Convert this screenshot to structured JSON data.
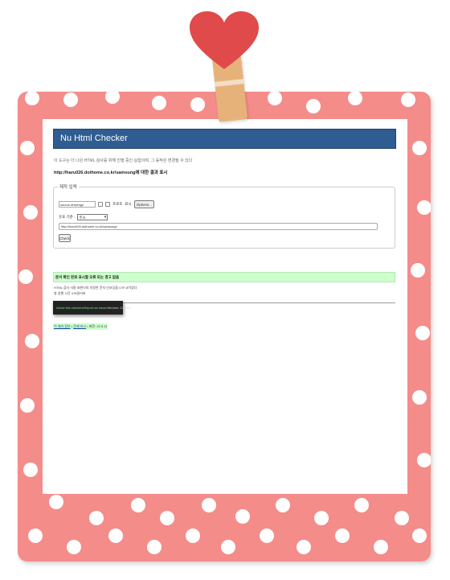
{
  "app": {
    "title": "Nu Html Checker"
  },
  "intro_text": "이 도구는 더 나은 HTML 검사를 위해 진행 중인 실험이며, 그 동작은 변경될 수 있다",
  "showing_results": "http://haru026.dothome.co.kr/samsung에 대한 결과 표시",
  "form": {
    "legend": "제작 입력",
    "source_select": "source.dhwenge",
    "out_label": "프로토",
    "show_label": "표시",
    "options_button": "Options...",
    "check_by_label": "유효 기준 :",
    "check_by_value": "주소",
    "url_value": "http://haru026.dothome.co.kr/samsung/",
    "check_button": "Check"
  },
  "result": {
    "success_message": "문서 확인 완료 표시할 오류 또는 경고 없음",
    "note_line1": "HTML 검사 사용 표현식의 지정한 문자 인코딩을 UTF-8이었다.",
    "note_line2": "총 실행 시간 476밀리초"
  },
  "tooltip": {
    "about": "About this checker",
    "sep1": " • ",
    "report": "Report an issue",
    "sep2": " • ",
    "version": "Version: 22.5.11"
  },
  "footer": {
    "about": "이 체커 정보",
    "sep1": " • ",
    "report": "문제 보고",
    "sep2": " • ",
    "version": "버전: 22.5.11"
  },
  "colors": {
    "frame": "#f48c8a",
    "header": "#2f5d92",
    "success_bg": "#ccffcc",
    "heart": "#e04a4a"
  }
}
